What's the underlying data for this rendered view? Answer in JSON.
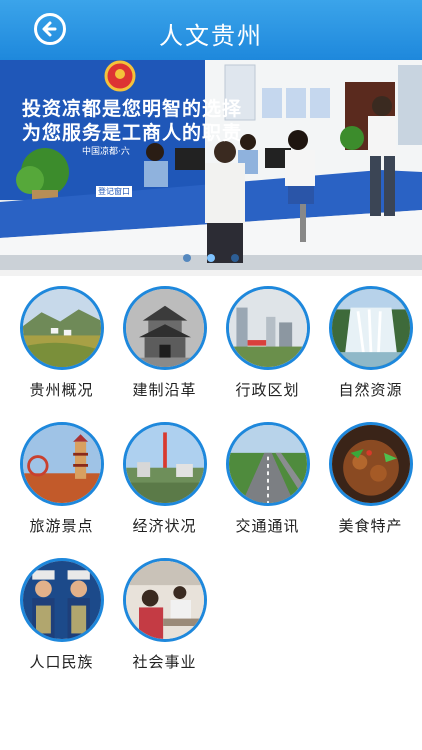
{
  "header": {
    "title": "人文贵州",
    "back_icon": "back-arrow-icon"
  },
  "banner": {
    "slogan_line1": "投资凉都是您明智的选择",
    "slogan_line2": "为您服务是工商人的职责",
    "slogan_sub": "中国凉都·六",
    "desk_sign": "登记窗口",
    "dots": 3,
    "active_dot": 1
  },
  "grid": {
    "items": [
      {
        "label": "贵州概况"
      },
      {
        "label": "建制沿革"
      },
      {
        "label": "行政区划"
      },
      {
        "label": "自然资源"
      },
      {
        "label": "旅游景点"
      },
      {
        "label": "经济状况"
      },
      {
        "label": "交通通讯"
      },
      {
        "label": "美食特产"
      },
      {
        "label": "人口民族"
      },
      {
        "label": "社会事业"
      }
    ]
  },
  "colors": {
    "header": "#1e88dc",
    "circle_border": "#1e88dc"
  }
}
